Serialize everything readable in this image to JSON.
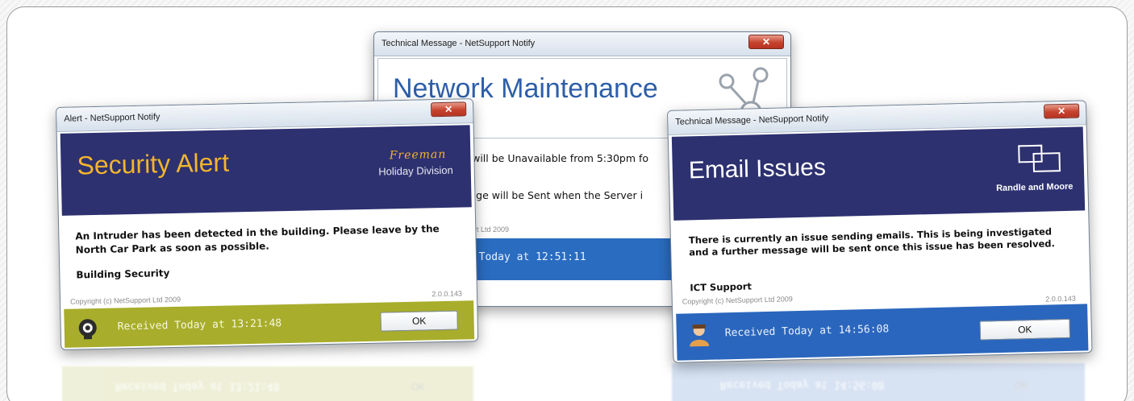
{
  "colors": {
    "banner_navy": "#2d3170",
    "security_footer": "#a8ad2c",
    "network_footer": "#2a6cc0",
    "email_footer": "#2a66bd",
    "security_title": "#f2b52c",
    "close_red": "#c5432e"
  },
  "network": {
    "window_title": "Technical Message - NetSupport Notify",
    "heading": "Network Maintenance",
    "line1": "r will be Unavailable from 5:30pm fo",
    "line2": "sage will be Sent when the Server i",
    "copyright": "port Ltd 2009",
    "received": "d Today at 12:51:11",
    "logo_icon": "network-nodes-icon"
  },
  "security": {
    "window_title": "Alert - NetSupport Notify",
    "heading": "Security Alert",
    "brand_name": "Freeman",
    "brand_division": "Holiday Division",
    "message": "An Intruder has been detected in the building. Please leave by the North Car Park as soon as possible.",
    "signature": "Building Security",
    "copyright": "Copyright (c) NetSupport Ltd 2009",
    "version": "2.0.0.143",
    "received": "Received Today at 13:21:48",
    "ok_label": "OK",
    "status_icon": "alarm-siren-icon"
  },
  "email": {
    "window_title": "Technical Message - NetSupport Notify",
    "heading": "Email Issues",
    "brand_name": "Randle and Moore",
    "message": "There is currently an issue sending emails. This is being investigated and a further message will be sent once this issue has been resolved.",
    "signature": "ICT Support",
    "copyright": "Copyright (c) NetSupport Ltd 2009",
    "version": "2.0.0.143",
    "received": "Received Today at 14:56:08",
    "ok_label": "OK",
    "status_icon": "person-icon",
    "logo_icon": "overlapping-squares-icon"
  },
  "reflections": {
    "security_received": "Received Today at 13:21:48",
    "security_ok": "OK",
    "email_received": "Received Today at 14:56:08",
    "email_ok": "OK"
  }
}
